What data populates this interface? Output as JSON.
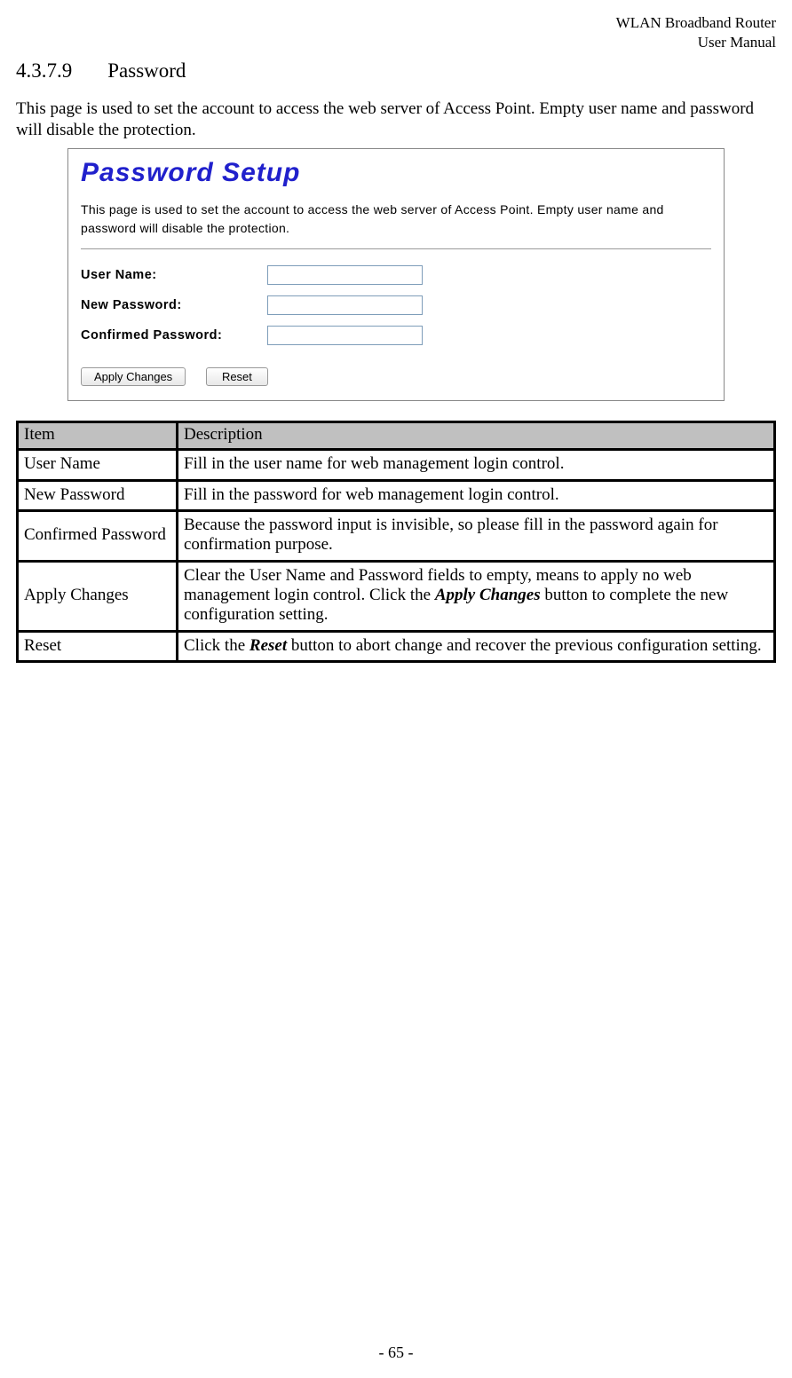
{
  "header": {
    "line1": "WLAN  Broadband  Router",
    "line2": "User  Manual"
  },
  "section": {
    "number": "4.3.7.9",
    "title": "Password"
  },
  "intro": "This page is used to set the account to access the web server of Access Point. Empty user name and password will disable the protection.",
  "screenshot": {
    "title": "Password Setup",
    "desc": "This page is used to set the account to access the web server of Access Point. Empty user name and password will disable the protection.",
    "fields": {
      "username_label": "User Name:",
      "newpass_label": "New Password:",
      "confpass_label": "Confirmed Password:"
    },
    "buttons": {
      "apply": "Apply Changes",
      "reset": "Reset"
    }
  },
  "table": {
    "headers": {
      "item": "Item",
      "desc": "Description"
    },
    "rows": [
      {
        "item": "User Name",
        "desc": "Fill in the user name for web management login control."
      },
      {
        "item": "New Password",
        "desc": "Fill in the password for web management login control."
      },
      {
        "item": "Confirmed Password",
        "desc": "Because the password input is invisible, so please fill in the password again for confirmation purpose."
      },
      {
        "item": "Apply Changes",
        "desc_pre": "Clear the User Name and Password fields to empty, means to apply no web management login control. Click the ",
        "desc_bold": "Apply Changes",
        "desc_post": " button to complete the new configuration setting."
      },
      {
        "item": "Reset",
        "desc_pre": "Click the ",
        "desc_bold": "Reset",
        "desc_post": " button to abort change and recover the previous configuration setting."
      }
    ]
  },
  "pagenum": "- 65 -"
}
